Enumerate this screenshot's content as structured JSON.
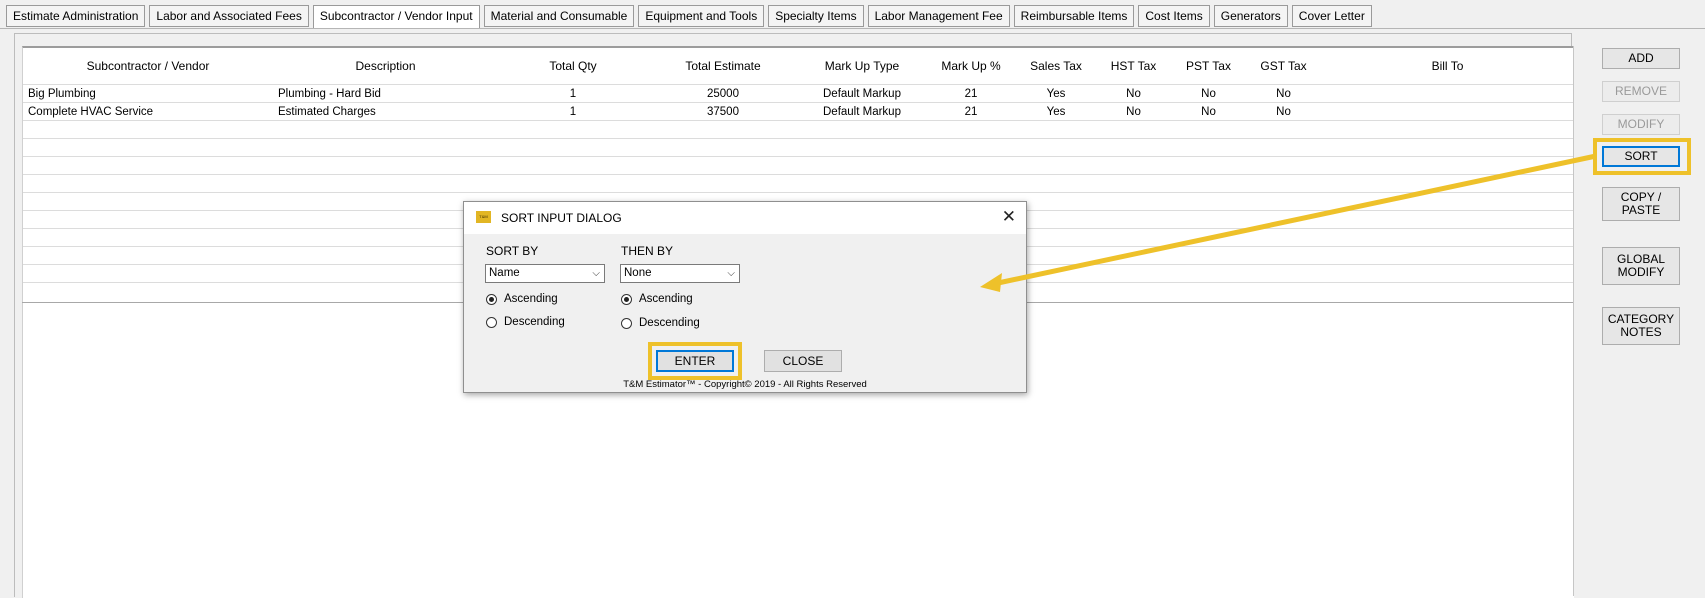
{
  "tabs": [
    {
      "label": "Estimate Administration"
    },
    {
      "label": "Labor and Associated Fees"
    },
    {
      "label": "Subcontractor / Vendor Input"
    },
    {
      "label": "Material and Consumable"
    },
    {
      "label": "Equipment and Tools"
    },
    {
      "label": "Specialty Items"
    },
    {
      "label": "Labor Management Fee"
    },
    {
      "label": "Reimbursable Items"
    },
    {
      "label": "Cost Items"
    },
    {
      "label": "Generators"
    },
    {
      "label": "Cover Letter"
    }
  ],
  "grid": {
    "columns": [
      "Subcontractor / Vendor",
      "Description",
      "Total Qty",
      "Total Estimate",
      "Mark Up Type",
      "Mark Up %",
      "Sales Tax",
      "HST Tax",
      "PST Tax",
      "GST Tax",
      "Bill To"
    ],
    "rows": [
      [
        "Big Plumbing",
        "Plumbing - Hard Bid",
        "1",
        "25000",
        "Default Markup",
        "21",
        "Yes",
        "No",
        "No",
        "No",
        ""
      ],
      [
        "Complete HVAC Service",
        "Estimated Charges",
        "1",
        "37500",
        "Default Markup",
        "21",
        "Yes",
        "No",
        "No",
        "No",
        ""
      ]
    ]
  },
  "side_buttons": {
    "add": "ADD",
    "remove": "REMOVE",
    "modify": "MODIFY",
    "sort": "SORT",
    "copy_paste_1": "COPY /",
    "copy_paste_2": "PASTE",
    "global_modify_1": "GLOBAL",
    "global_modify_2": "MODIFY",
    "category_notes_1": "CATEGORY",
    "category_notes_2": "NOTES"
  },
  "dialog": {
    "logo_text": "T&M",
    "title": "SORT INPUT DIALOG",
    "sort_by_label": "SORT BY",
    "sort_by_value": "Name",
    "then_by_label": "THEN BY",
    "then_by_value": "None",
    "ascending": "Ascending",
    "descending": "Descending",
    "enter": "ENTER",
    "close": "CLOSE",
    "copyright": "T&M Estimator™ - Copyright© 2019 - All Rights Reserved"
  },
  "colors": {
    "highlight": "#eec12a",
    "focus": "#0078d7"
  }
}
